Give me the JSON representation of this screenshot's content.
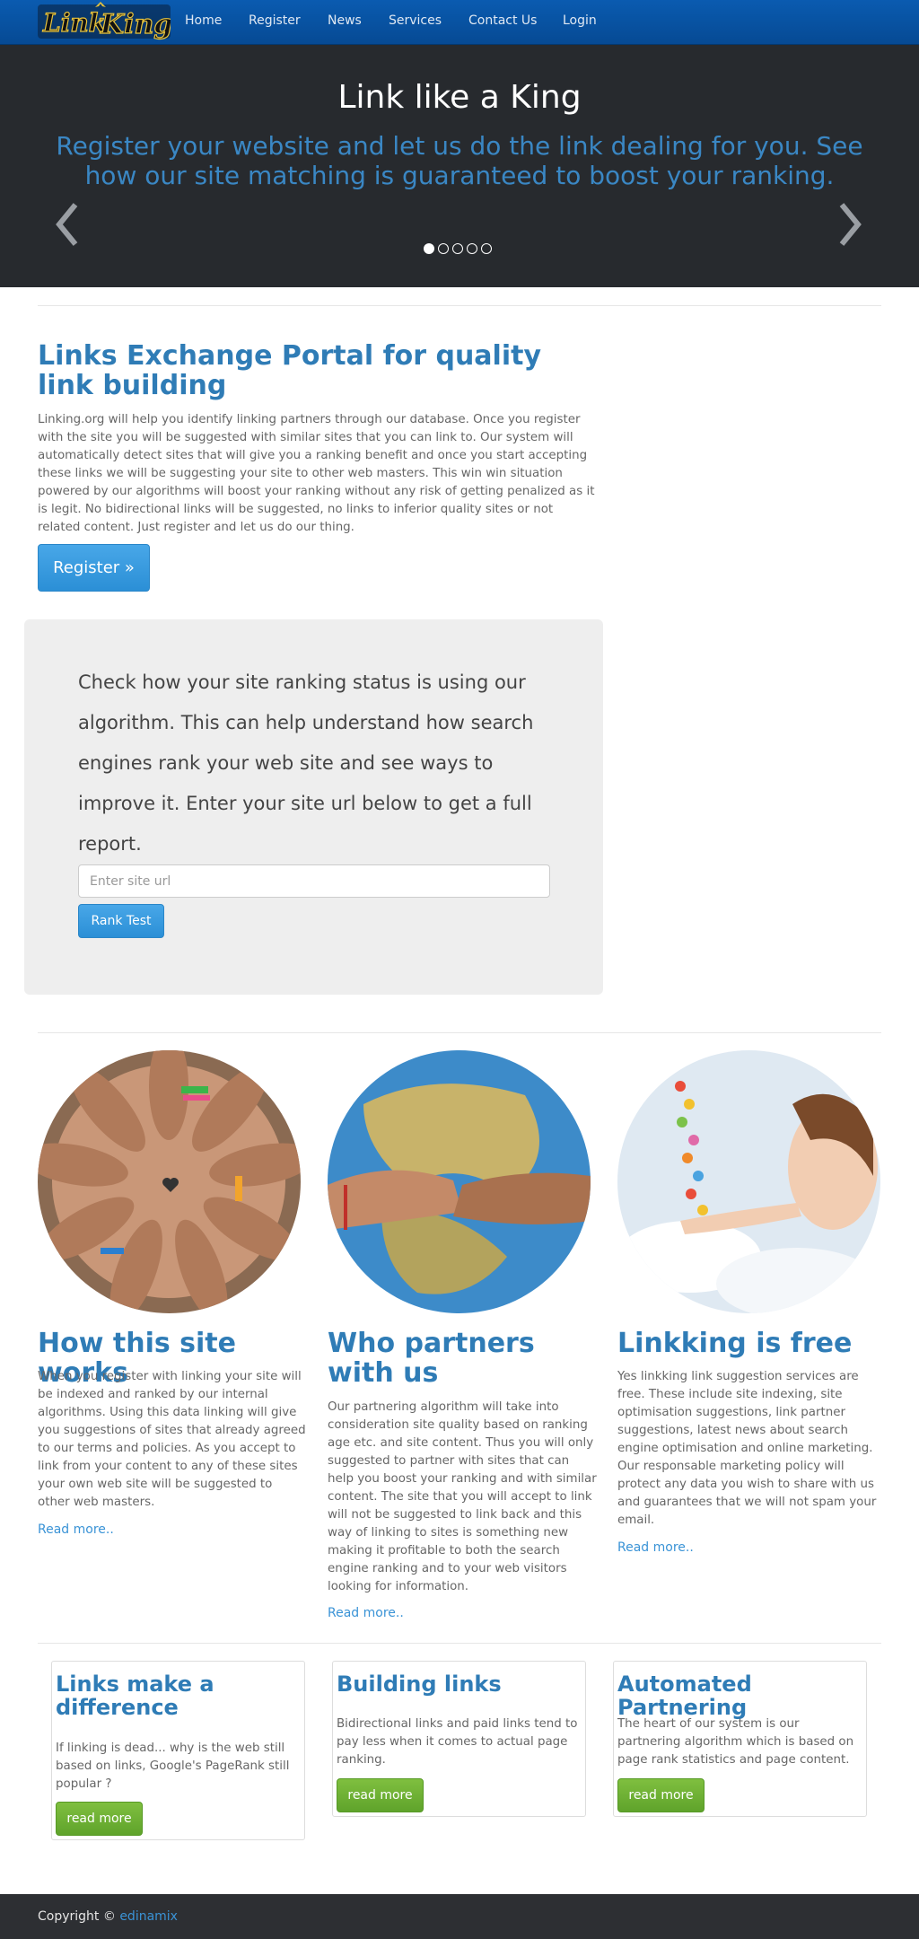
{
  "brand": {
    "logo_text_1": "Link",
    "logo_text_2": "King"
  },
  "nav": {
    "items": [
      {
        "label": "Home"
      },
      {
        "label": "Register"
      },
      {
        "label": "News"
      },
      {
        "label": "Services"
      },
      {
        "label": "Contact Us"
      },
      {
        "label": "Login"
      }
    ]
  },
  "hero": {
    "title": "Link like a King",
    "subtitle": "Register your website and let us do the link dealing for you. See how our site matching is guaranteed to boost your ranking.",
    "slides": 5,
    "active_slide": 1
  },
  "intro": {
    "title": "Links Exchange Portal for quality link building",
    "text": "Linking.org will help you identify linking partners through our database. Once you register with the site you will be suggested with similar sites that you can link to. Our system will automatically detect sites that will give you a ranking benefit and once you start accepting these links we will be suggesting your site to other web masters. This win win situation powered by our algorithms will boost your ranking without any risk of getting penalized as it is legit. No bidirectional links will be suggested, no links to inferior quality sites or not related content. Just register and let us do our thing.",
    "register_label": "Register »"
  },
  "rank": {
    "text": "Check how your site ranking status is using our algorithm. This can help understand how search engines rank your web site and see ways to improve it. Enter your site url below to get a full report.",
    "placeholder": "Enter site url",
    "button_label": "Rank Test"
  },
  "features": [
    {
      "title": "How this site works",
      "text": "When you register with linking your site will be indexed and ranked by our internal algorithms. Using this data linking will give you suggestions of sites that already agreed to our terms and policies. As you accept to link from your content to any of these sites your own web site will be suggested to other web masters.",
      "link": "Read more.."
    },
    {
      "title": "Who partners with us",
      "text": "Our partnering algorithm will take into consideration site quality based on ranking age etc. and site content. Thus you will only suggested to partner with sites that can help you boost your ranking and with similar content. The site that you will accept to link will not be suggested to link back and this way of linking to sites is something new making it profitable to both the search engine ranking and to your web visitors looking for information.",
      "link": "Read more.."
    },
    {
      "title": "Linkking is free",
      "text": "Yes linkking link suggestion services are free. These include site indexing, site optimisation suggestions, link partner suggestions, latest news about search engine optimisation and online marketing. Our responsable marketing policy will protect any data you wish to share with us and guarantees that we will not spam your email.",
      "link": "Read more.."
    }
  ],
  "cards": [
    {
      "title": "Links make a difference",
      "text": "If linking is dead... why is the web still based on links, Google's PageRank still popular ?",
      "button": "read more"
    },
    {
      "title": "Building links",
      "text": "Bidirectional links and paid links tend to pay less when it comes to actual page ranking.",
      "button": "read more"
    },
    {
      "title": "Automated Partnering",
      "text": "The heart of our system is our partnering algorithm which is based on page rank statistics and page content.",
      "button": "read more"
    }
  ],
  "footer": {
    "copyright": "Copyright ©",
    "author": "edinamix"
  },
  "colors": {
    "nav_bg": "#0a5bb0",
    "hero_bg": "#272a2e",
    "heading_blue": "#2f7cb6",
    "button_blue": "#3a9be0",
    "button_green": "#6cae33",
    "footer_bg": "#2d2f33"
  }
}
